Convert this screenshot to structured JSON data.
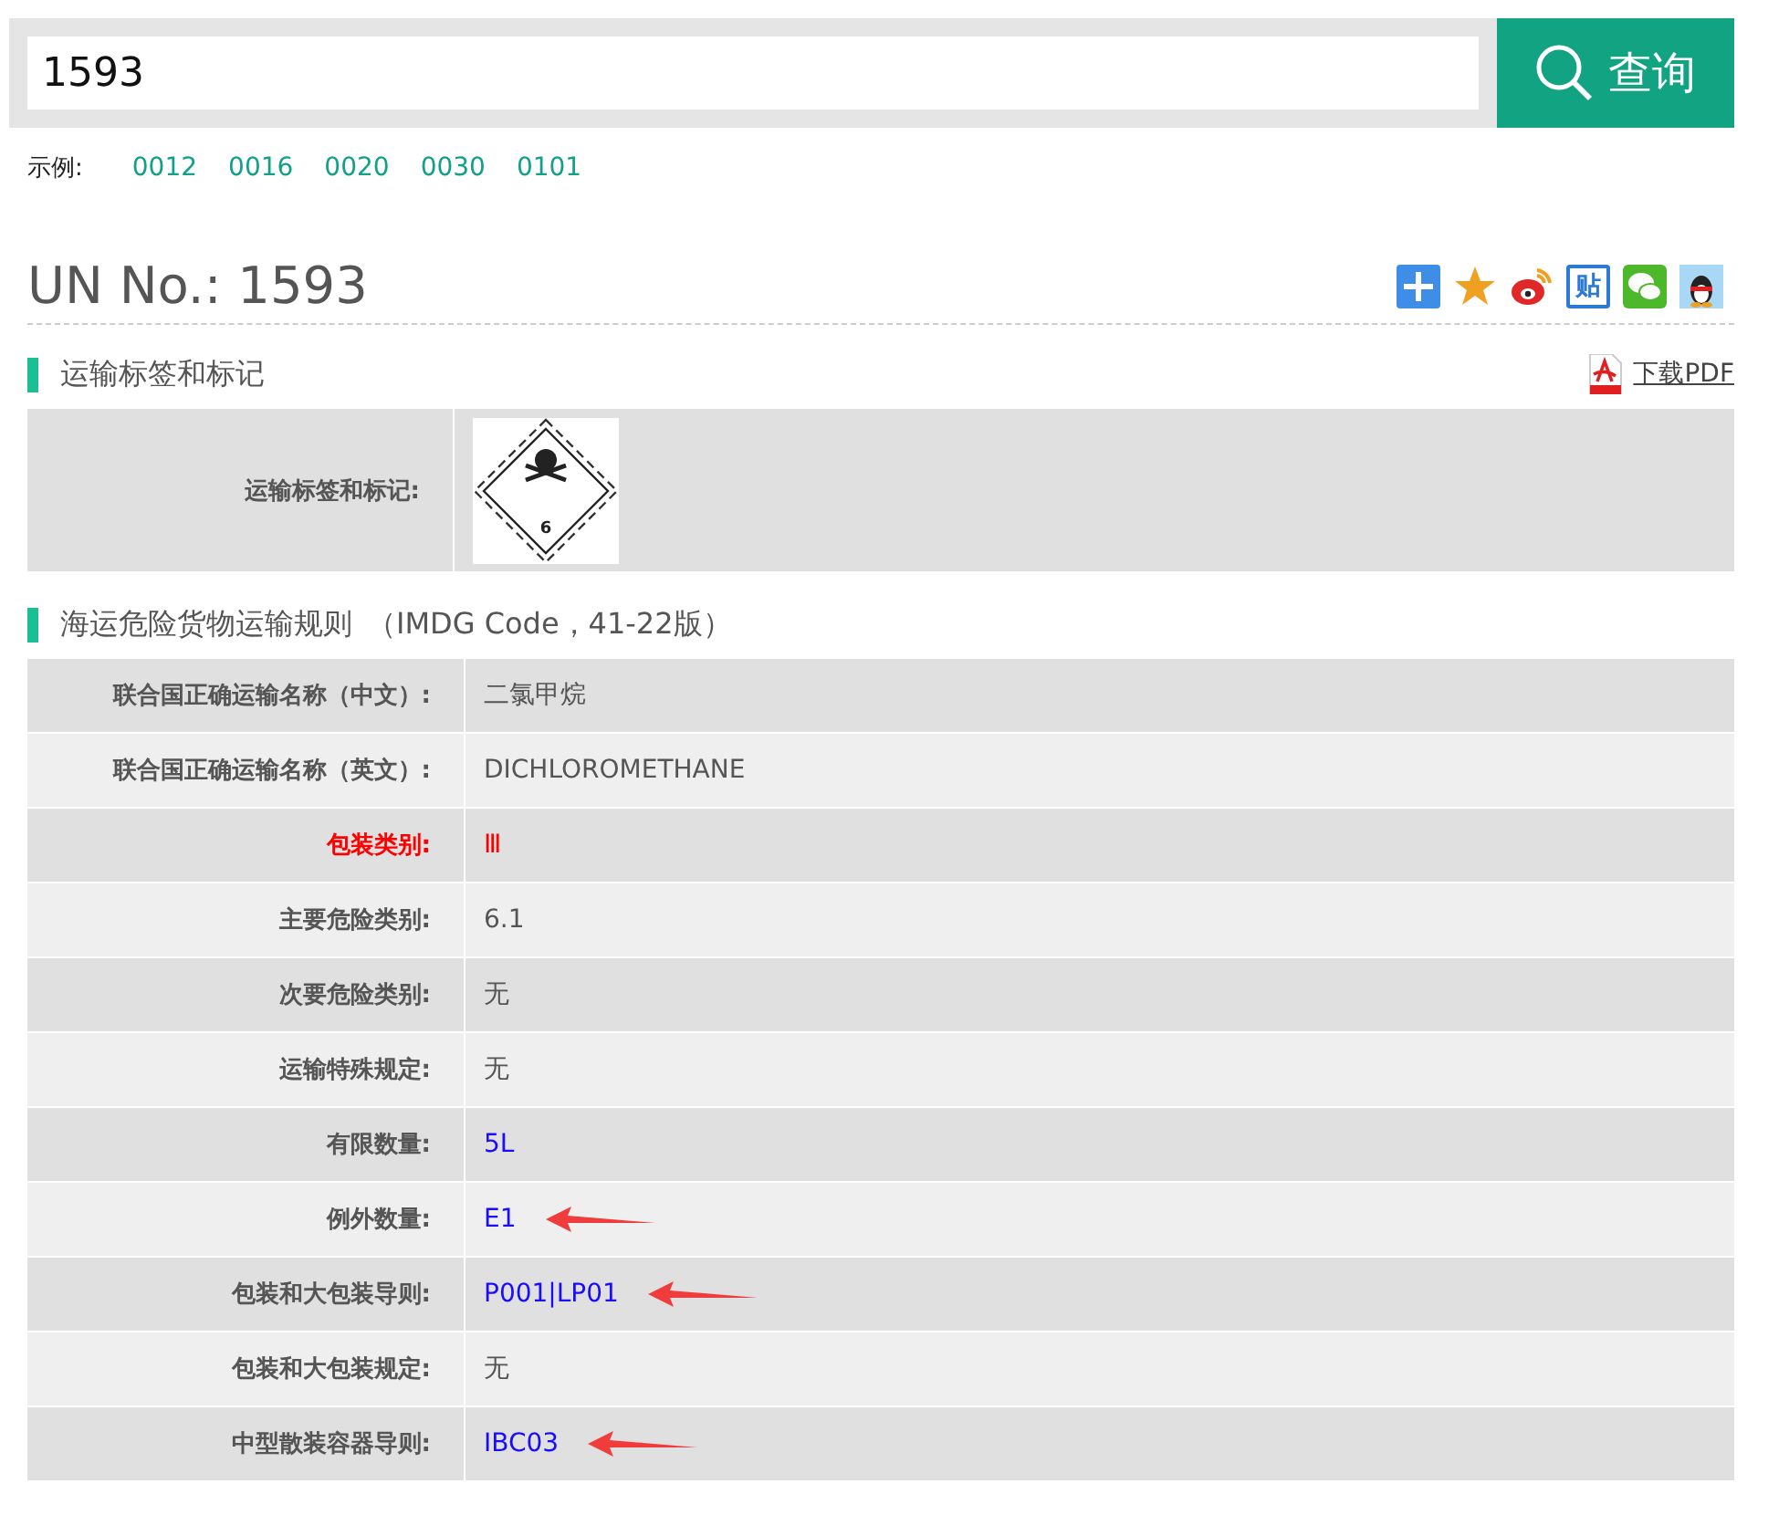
{
  "search": {
    "value": "1593",
    "button": "查询"
  },
  "examples": {
    "label": "示例:",
    "links": [
      "0012",
      "0016",
      "0020",
      "0030",
      "0101"
    ]
  },
  "title": "UN No.:  1593",
  "share_icons": [
    {
      "kind": "plus"
    },
    {
      "kind": "star"
    },
    {
      "kind": "swirl"
    },
    {
      "kind": "glyph",
      "text": "贴"
    },
    {
      "kind": "chat"
    },
    {
      "kind": "penguin"
    }
  ],
  "section_1": {
    "heading": "运输标签和标记",
    "download": "下载PDF",
    "label": "运输标签和标记:",
    "hazard_class": "6"
  },
  "section_2": {
    "heading": "海运危险货物运输规则",
    "note": "（IMDG Code，41-22版）",
    "rows": [
      {
        "label": "联合国正确运输名称（中文）:",
        "value": "二氯甲烷",
        "kind": "plain",
        "arrow": false
      },
      {
        "label": "联合国正确运输名称（英文）:",
        "value": "DICHLOROMETHANE",
        "kind": "plain",
        "arrow": false
      },
      {
        "label": "包装类别:",
        "value": "Ⅲ",
        "kind": "alert",
        "arrow": false
      },
      {
        "label": "主要危险类别:",
        "value": "6.1",
        "kind": "plain",
        "arrow": false
      },
      {
        "label": "次要危险类别:",
        "value": "无",
        "kind": "plain",
        "arrow": false
      },
      {
        "label": "运输特殊规定:",
        "value": "无",
        "kind": "plain",
        "arrow": false
      },
      {
        "label": "有限数量:",
        "value": "5L",
        "kind": "link",
        "arrow": false
      },
      {
        "label": "例外数量:",
        "value": "E1",
        "kind": "link",
        "arrow": true
      },
      {
        "label": "包装和大包装导则:",
        "value": "P001|LP01",
        "kind": "link",
        "arrow": true
      },
      {
        "label": "包装和大包装规定:",
        "value": "无",
        "kind": "plain",
        "arrow": false
      },
      {
        "label": "中型散装容器导则:",
        "value": "IBC03",
        "kind": "link",
        "arrow": true
      }
    ]
  }
}
